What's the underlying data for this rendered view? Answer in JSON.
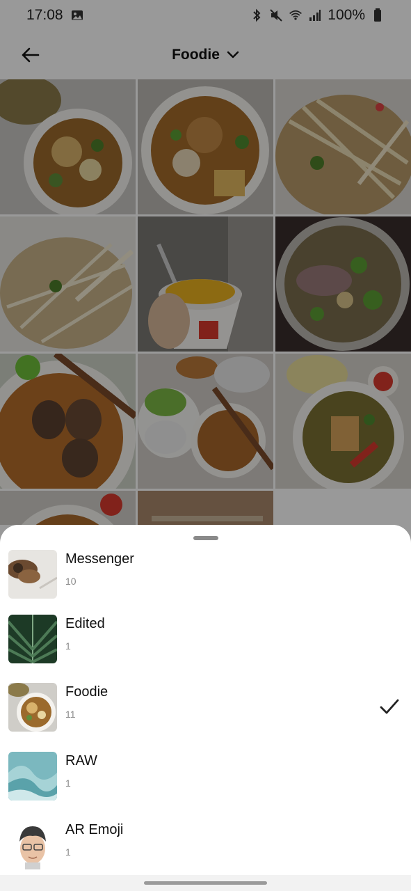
{
  "status_bar": {
    "time": "17:08",
    "battery": "100%",
    "icons": [
      "gallery-notification-icon",
      "bluetooth-icon",
      "mute-icon",
      "wifi-icon",
      "signal-icon",
      "battery-icon"
    ]
  },
  "app_bar": {
    "title": "Foodie",
    "back_icon": "arrow-left-icon",
    "dropdown_icon": "chevron-down-icon"
  },
  "albums": [
    {
      "name": "Messenger",
      "count": "10",
      "thumb": "dog-photo"
    },
    {
      "name": "Edited",
      "count": "1",
      "thumb": "leaf-photo"
    },
    {
      "name": "Foodie",
      "count": "11",
      "thumb": "noodle-soup-photo",
      "selected": true
    },
    {
      "name": "RAW",
      "count": "1",
      "thumb": "blue-wave-photo"
    },
    {
      "name": "AR Emoji",
      "count": "1",
      "thumb": "ar-emoji-avatar"
    }
  ],
  "colors": {
    "scrim": "#000000",
    "sheet": "#ffffff",
    "accent_check": "#222222"
  }
}
